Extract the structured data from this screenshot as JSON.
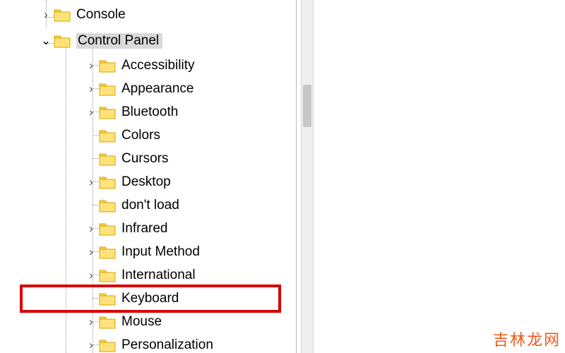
{
  "tree": {
    "root": [
      {
        "label": "Console",
        "expander": "right"
      },
      {
        "label": "Control Panel",
        "expander": "down",
        "selected": true
      }
    ],
    "children": [
      {
        "label": "Accessibility",
        "expander": "right"
      },
      {
        "label": "Appearance",
        "expander": "right"
      },
      {
        "label": "Bluetooth",
        "expander": "right"
      },
      {
        "label": "Colors",
        "expander": "none"
      },
      {
        "label": "Cursors",
        "expander": "none"
      },
      {
        "label": "Desktop",
        "expander": "right"
      },
      {
        "label": "don't load",
        "expander": "none"
      },
      {
        "label": "Infrared",
        "expander": "right"
      },
      {
        "label": "Input Method",
        "expander": "right"
      },
      {
        "label": "International",
        "expander": "right"
      },
      {
        "label": "Keyboard",
        "expander": "none",
        "highlight": true
      },
      {
        "label": "Mouse",
        "expander": "right"
      },
      {
        "label": "Personalization",
        "expander": "right"
      }
    ]
  },
  "watermark": "吉林龙网"
}
